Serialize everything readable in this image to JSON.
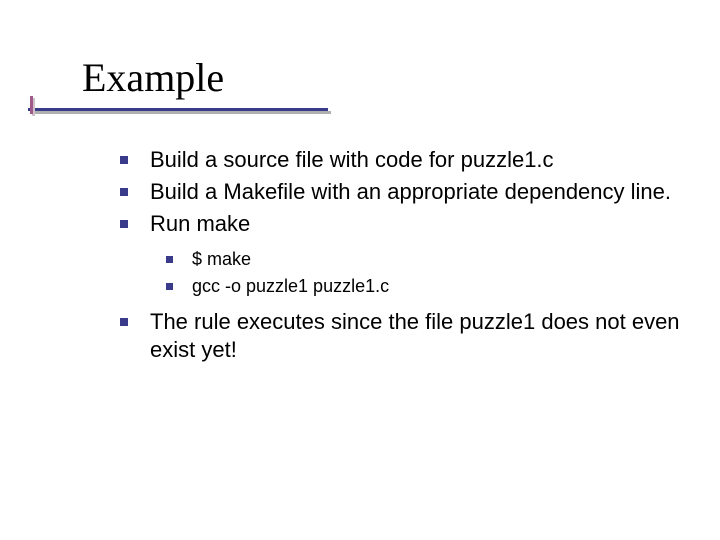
{
  "title": "Example",
  "bullets": {
    "b1": "Build a source file with code for puzzle1.c",
    "b2": "Build a Makefile with an appropriate dependency line.",
    "b3": "Run make",
    "b3_sub1": "$ make",
    "b3_sub2": "gcc -o puzzle1 puzzle1.c",
    "b4": "The rule executes since the file puzzle1 does not even exist yet!"
  }
}
